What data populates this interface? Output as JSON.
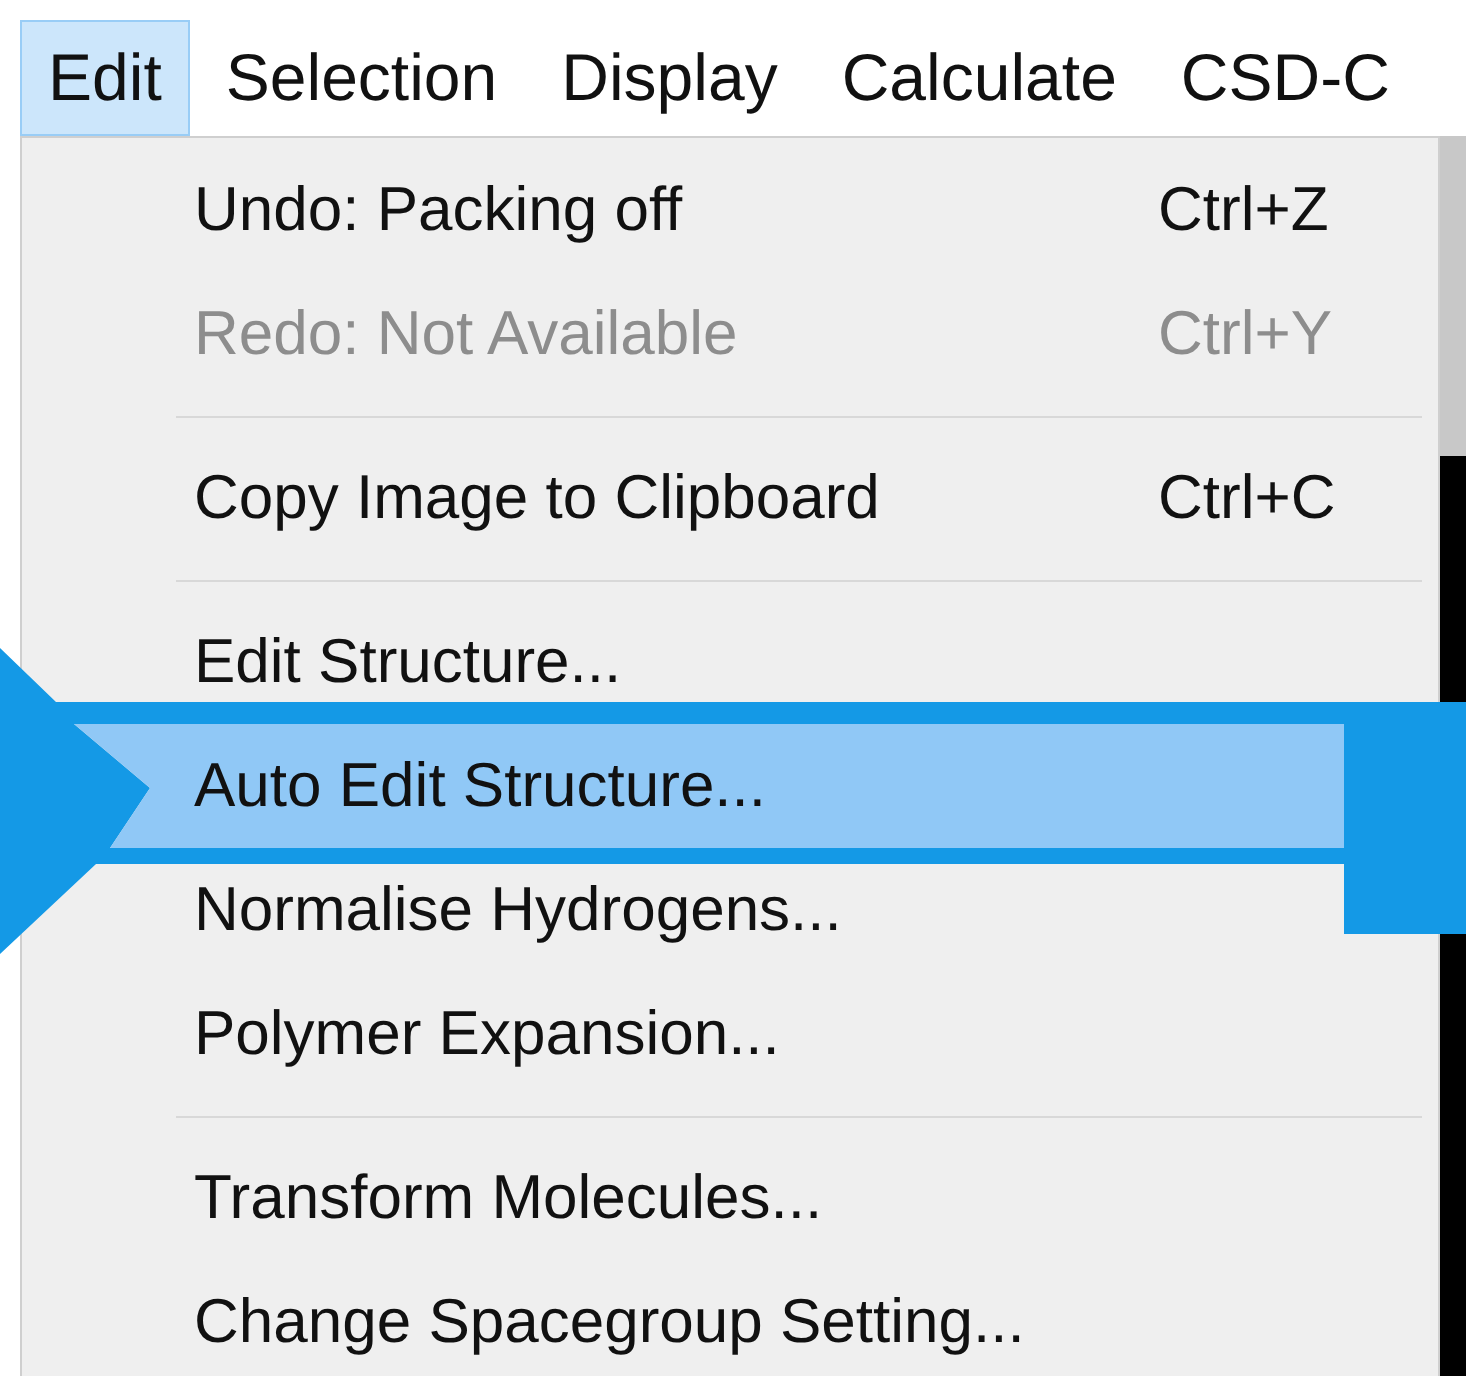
{
  "menubar": [
    {
      "label": "Edit",
      "selected": true
    },
    {
      "label": "Selection",
      "selected": false
    },
    {
      "label": "Display",
      "selected": false
    },
    {
      "label": "Calculate",
      "selected": false
    },
    {
      "label": "CSD-C",
      "selected": false
    }
  ],
  "menu": [
    {
      "kind": "item",
      "label": "Undo: Packing off",
      "shortcut": "Ctrl+Z",
      "disabled": false,
      "selected": false
    },
    {
      "kind": "item",
      "label": "Redo: Not Available",
      "shortcut": "Ctrl+Y",
      "disabled": true,
      "selected": false
    },
    {
      "kind": "separator"
    },
    {
      "kind": "item",
      "label": "Copy Image to Clipboard",
      "shortcut": "Ctrl+C",
      "disabled": false,
      "selected": false
    },
    {
      "kind": "separator"
    },
    {
      "kind": "item",
      "label": "Edit Structure...",
      "disabled": false,
      "selected": false
    },
    {
      "kind": "item",
      "label": "Auto Edit Structure...",
      "disabled": false,
      "selected": true
    },
    {
      "kind": "item",
      "label": "Normalise Hydrogens...",
      "disabled": false,
      "selected": false
    },
    {
      "kind": "item",
      "label": "Polymer Expansion...",
      "disabled": false,
      "selected": false
    },
    {
      "kind": "separator"
    },
    {
      "kind": "item",
      "label": "Transform Molecules...",
      "disabled": false,
      "selected": false
    },
    {
      "kind": "item",
      "label": "Change Spacegroup Setting...",
      "disabled": false,
      "selected": false
    }
  ]
}
